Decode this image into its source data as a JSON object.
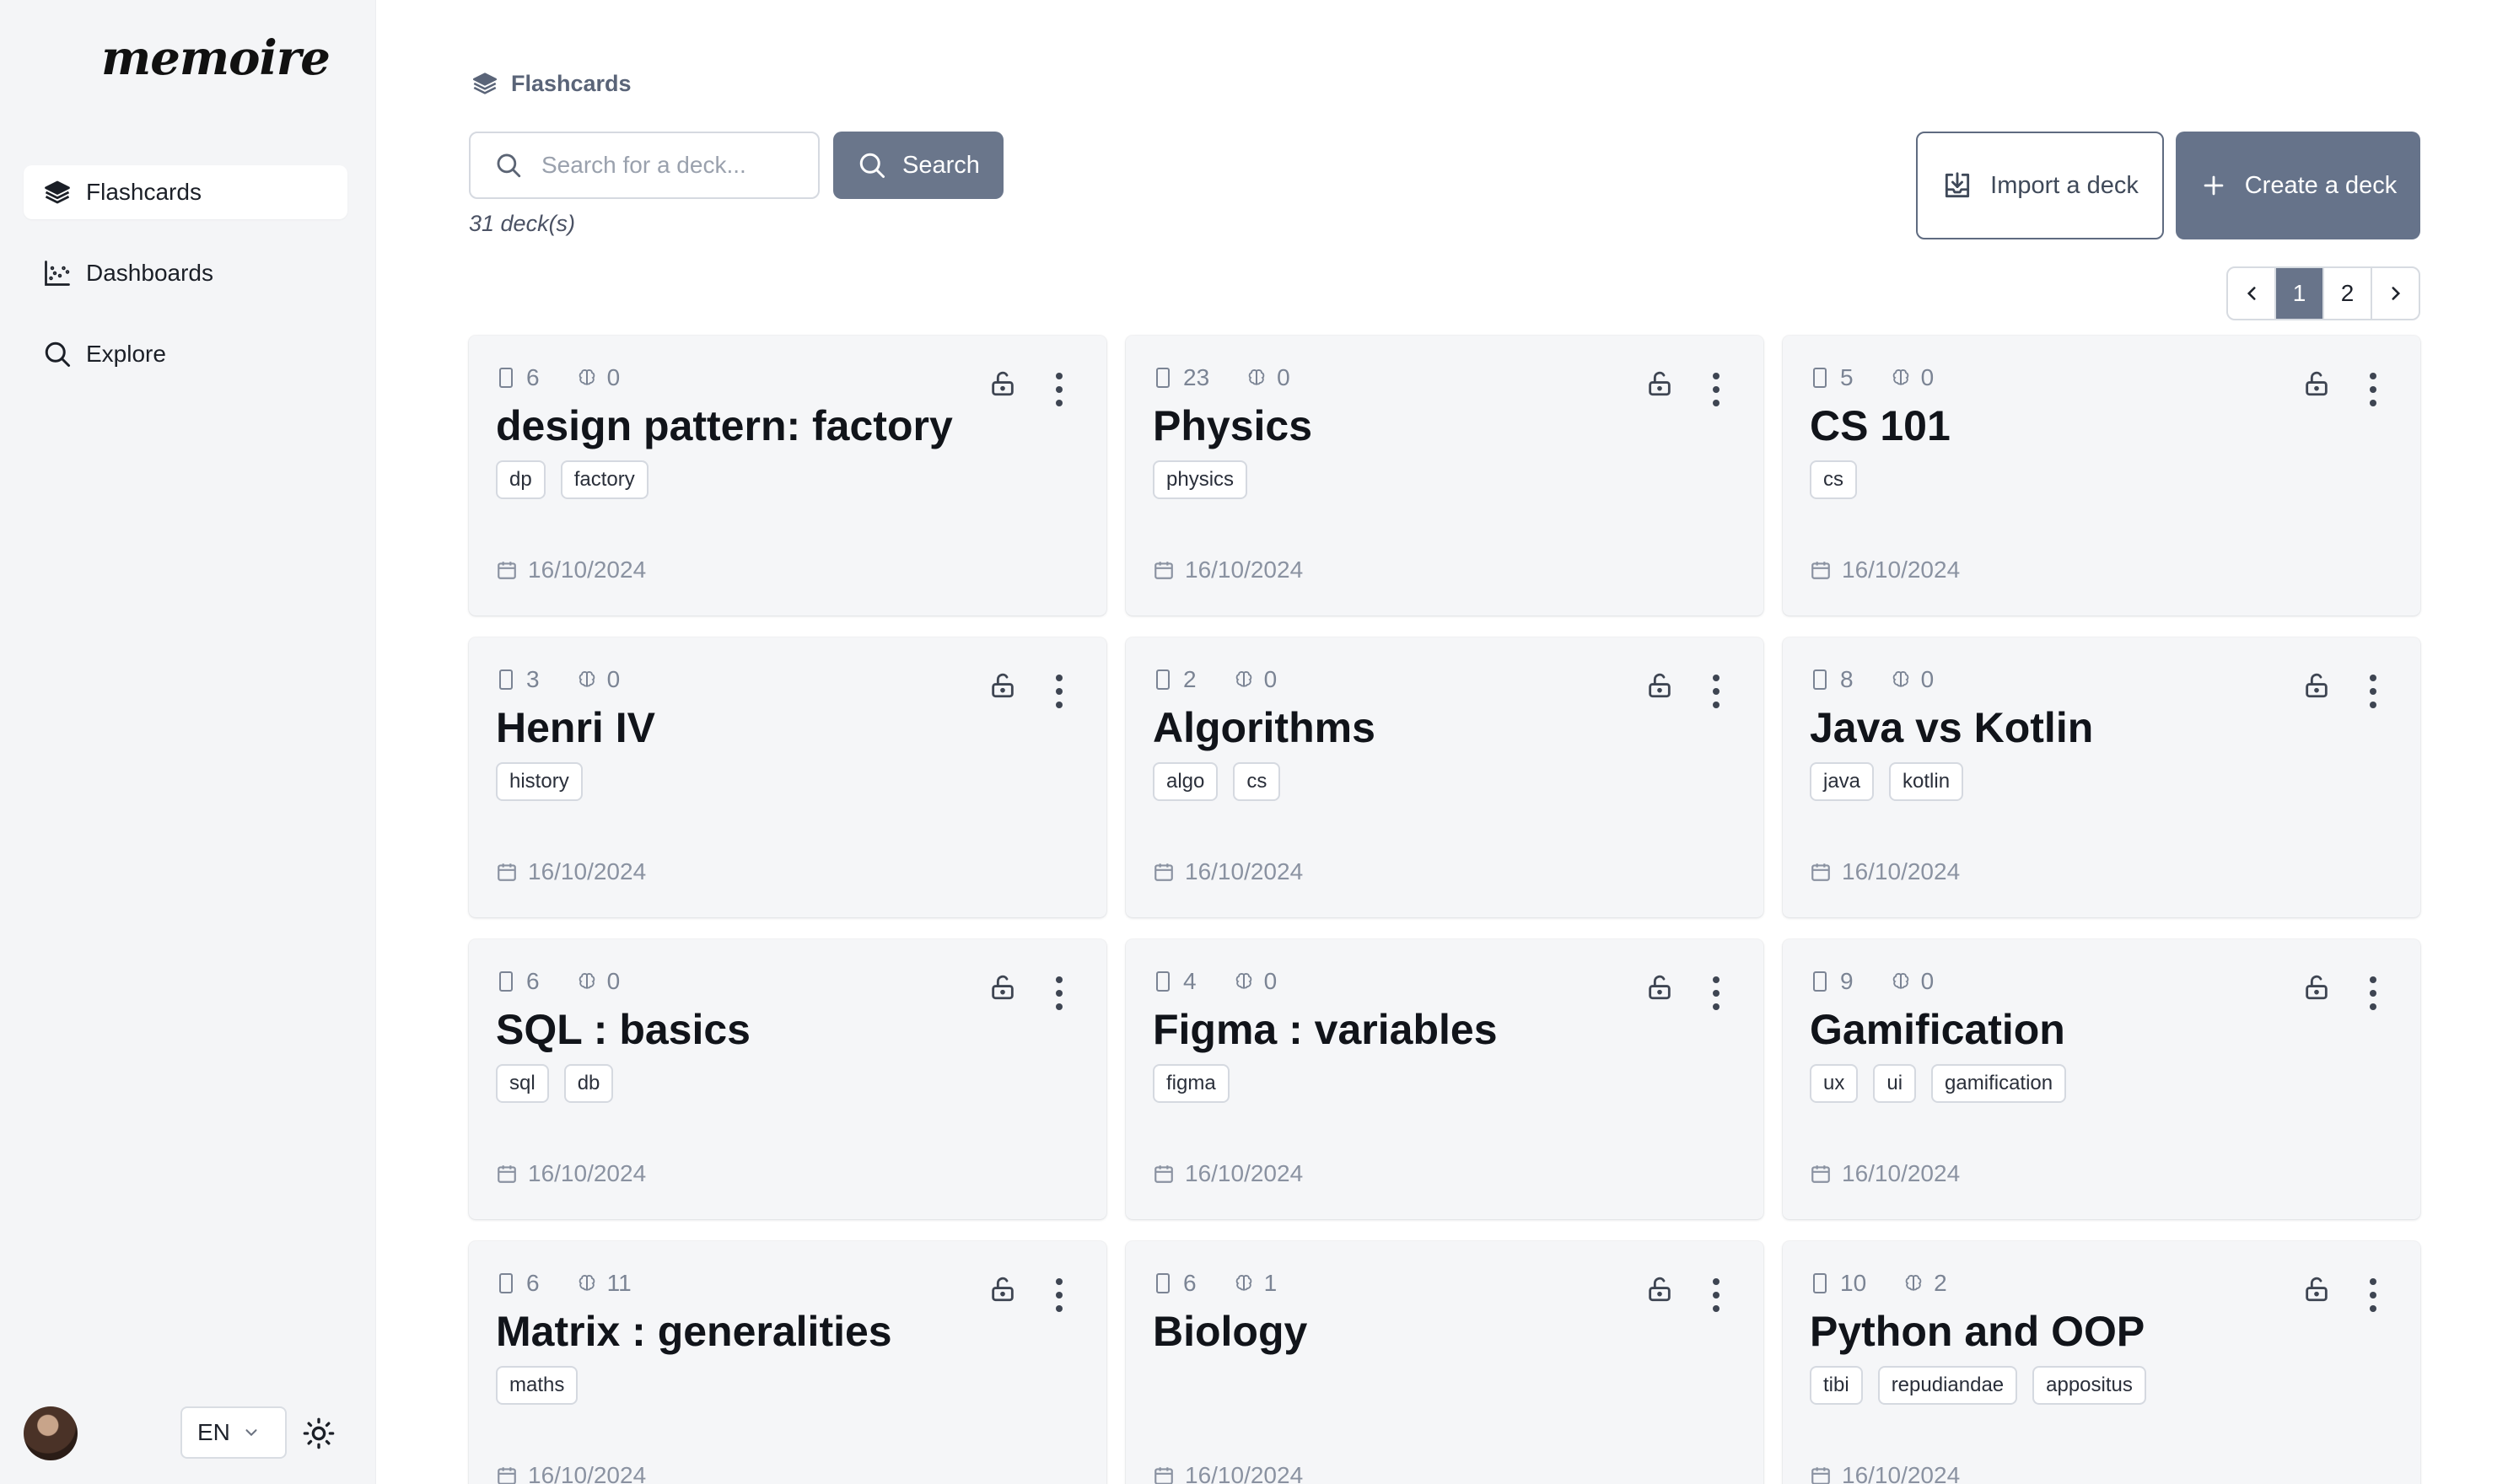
{
  "app": {
    "logo": "memoire"
  },
  "sidebar": {
    "items": [
      {
        "label": "Flashcards",
        "icon": "layers-icon",
        "active": true
      },
      {
        "label": "Dashboards",
        "icon": "chart-icon"
      },
      {
        "label": "Explore",
        "icon": "search-icon"
      }
    ],
    "language": "EN"
  },
  "header": {
    "breadcrumb": "Flashcards",
    "search_placeholder": "Search for a deck...",
    "search_label": "Search",
    "deck_count": "31 deck(s)",
    "import_label": "Import a deck",
    "create_label": "Create a deck"
  },
  "pagination": {
    "pages": [
      "1",
      "2"
    ],
    "current": "1"
  },
  "decks": [
    {
      "cards": "6",
      "learned": "0",
      "title": "design pattern: factory",
      "tags": [
        "dp",
        "factory"
      ],
      "date": "16/10/2024"
    },
    {
      "cards": "23",
      "learned": "0",
      "title": "Physics",
      "tags": [
        "physics"
      ],
      "date": "16/10/2024"
    },
    {
      "cards": "5",
      "learned": "0",
      "title": "CS 101",
      "tags": [
        "cs"
      ],
      "date": "16/10/2024"
    },
    {
      "cards": "3",
      "learned": "0",
      "title": "Henri IV",
      "tags": [
        "history"
      ],
      "date": "16/10/2024"
    },
    {
      "cards": "2",
      "learned": "0",
      "title": "Algorithms",
      "tags": [
        "algo",
        "cs"
      ],
      "date": "16/10/2024"
    },
    {
      "cards": "8",
      "learned": "0",
      "title": "Java vs Kotlin",
      "tags": [
        "java",
        "kotlin"
      ],
      "date": "16/10/2024"
    },
    {
      "cards": "6",
      "learned": "0",
      "title": "SQL : basics",
      "tags": [
        "sql",
        "db"
      ],
      "date": "16/10/2024"
    },
    {
      "cards": "4",
      "learned": "0",
      "title": "Figma : variables",
      "tags": [
        "figma"
      ],
      "date": "16/10/2024"
    },
    {
      "cards": "9",
      "learned": "0",
      "title": "Gamification",
      "tags": [
        "ux",
        "ui",
        "gamification"
      ],
      "date": "16/10/2024"
    },
    {
      "cards": "6",
      "learned": "11",
      "title": "Matrix : generalities",
      "tags": [
        "maths"
      ],
      "date": "16/10/2024"
    },
    {
      "cards": "6",
      "learned": "1",
      "title": "Biology",
      "tags": [],
      "date": "16/10/2024"
    },
    {
      "cards": "10",
      "learned": "2",
      "title": "Python and OOP",
      "tags": [
        "tibi",
        "repudiandae",
        "appositus"
      ],
      "date": "16/10/2024"
    }
  ]
}
